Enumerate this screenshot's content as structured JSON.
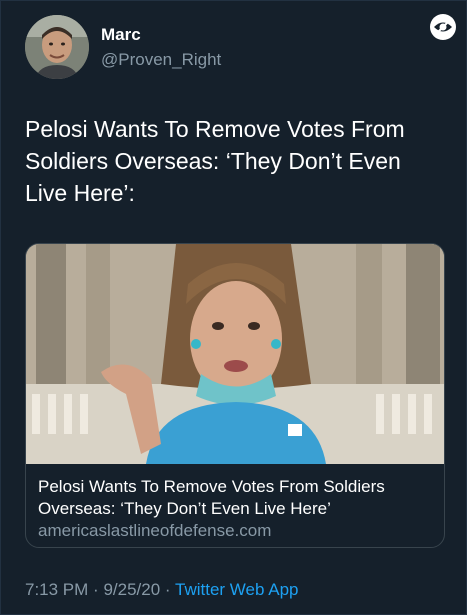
{
  "author": {
    "name": "Marc",
    "handle": "@Proven_Right"
  },
  "tweet": {
    "text": "Pelosi Wants To Remove Votes From Soldiers Overseas: ‘They Don’t Even Live Here’:"
  },
  "card": {
    "title": "Pelosi Wants To Remove Votes From Soldiers Overseas: ‘They Don’t Even Live Here’",
    "domain": "americaslastlineofdefense.com",
    "image_icon": "photo-of-speaker"
  },
  "meta": {
    "time": "7:13 PM",
    "date": "9/25/20",
    "separator": "·",
    "app": "Twitter Web App"
  },
  "icons": {
    "top_right": "eye-icon"
  },
  "colors": {
    "background": "#15202b",
    "secondary_text": "#8899a6",
    "link": "#1da1f2",
    "card_border": "#38444d"
  }
}
